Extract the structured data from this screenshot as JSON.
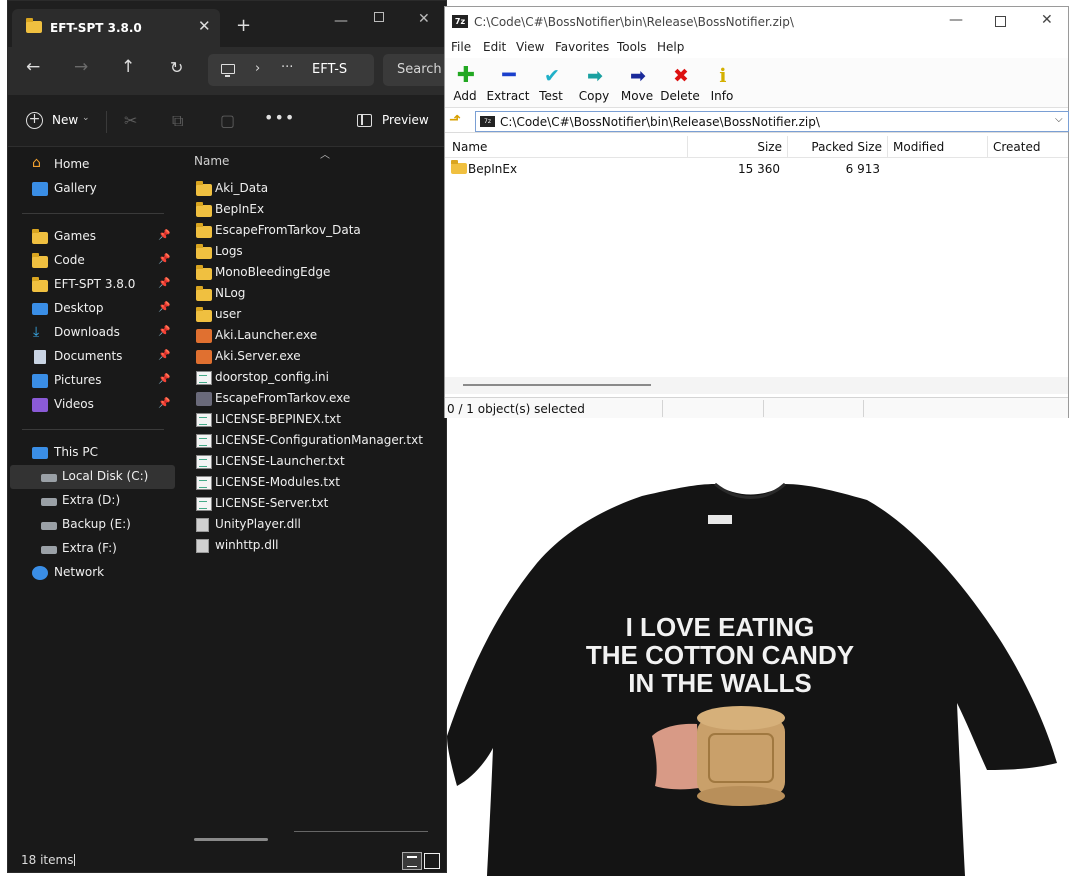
{
  "explorer": {
    "tab_title": "EFT-SPT 3.8.0",
    "address_text": "EFT-S",
    "search_placeholder": "Search",
    "toolbar": {
      "new_label": "New",
      "preview_label": "Preview"
    },
    "column_name": "Name",
    "sidebar": [
      {
        "label": "Home",
        "icon": "home-icon"
      },
      {
        "label": "Gallery",
        "icon": "gallery-icon"
      },
      {
        "label": "Games",
        "icon": "folder-icon",
        "pinned": true
      },
      {
        "label": "Code",
        "icon": "folder-icon",
        "pinned": true
      },
      {
        "label": "EFT-SPT 3.8.0",
        "icon": "folder-icon",
        "pinned": true
      },
      {
        "label": "Desktop",
        "icon": "desktop-icon",
        "pinned": true
      },
      {
        "label": "Downloads",
        "icon": "download-icon",
        "pinned": true
      },
      {
        "label": "Documents",
        "icon": "documents-icon",
        "pinned": true
      },
      {
        "label": "Pictures",
        "icon": "pictures-icon",
        "pinned": true
      },
      {
        "label": "Videos",
        "icon": "videos-icon",
        "pinned": true
      },
      {
        "label": "This PC",
        "icon": "pc-icon"
      },
      {
        "label": "Local Disk (C:)",
        "icon": "drive-icon",
        "selected": true
      },
      {
        "label": "Extra (D:)",
        "icon": "drive-icon"
      },
      {
        "label": "Backup (E:)",
        "icon": "drive-icon"
      },
      {
        "label": "Extra (F:)",
        "icon": "drive-icon"
      },
      {
        "label": "Network",
        "icon": "network-icon"
      }
    ],
    "files": [
      {
        "name": "Aki_Data",
        "type": "folder"
      },
      {
        "name": "BepInEx",
        "type": "folder"
      },
      {
        "name": "EscapeFromTarkov_Data",
        "type": "folder"
      },
      {
        "name": "Logs",
        "type": "folder"
      },
      {
        "name": "MonoBleedingEdge",
        "type": "folder"
      },
      {
        "name": "NLog",
        "type": "folder"
      },
      {
        "name": "user",
        "type": "folder"
      },
      {
        "name": "Aki.Launcher.exe",
        "type": "exe"
      },
      {
        "name": "Aki.Server.exe",
        "type": "exe"
      },
      {
        "name": "doorstop_config.ini",
        "type": "txt"
      },
      {
        "name": "EscapeFromTarkov.exe",
        "type": "exe2"
      },
      {
        "name": "LICENSE-BEPINEX.txt",
        "type": "txt"
      },
      {
        "name": "LICENSE-ConfigurationManager.txt",
        "type": "txt"
      },
      {
        "name": "LICENSE-Launcher.txt",
        "type": "txt"
      },
      {
        "name": "LICENSE-Modules.txt",
        "type": "txt"
      },
      {
        "name": "LICENSE-Server.txt",
        "type": "txt"
      },
      {
        "name": "UnityPlayer.dll",
        "type": "dll"
      },
      {
        "name": "winhttp.dll",
        "type": "dll"
      }
    ],
    "status_text": "18 items"
  },
  "zip": {
    "title": "C:\\Code\\C#\\BossNotifier\\bin\\Release\\BossNotifier.zip\\",
    "logo": "7z",
    "menu": [
      "File",
      "Edit",
      "View",
      "Favorites",
      "Tools",
      "Help"
    ],
    "tools": [
      {
        "label": "Add",
        "icon": "add-icon",
        "color": "#22a822"
      },
      {
        "label": "Extract",
        "icon": "extract-icon",
        "color": "#1a3fcc"
      },
      {
        "label": "Test",
        "icon": "test-icon",
        "color": "#20b0c8"
      },
      {
        "label": "Copy",
        "icon": "copy-icon",
        "color": "#1aa0a0"
      },
      {
        "label": "Move",
        "icon": "move-icon",
        "color": "#1a2a9a"
      },
      {
        "label": "Delete",
        "icon": "delete-icon",
        "color": "#dd1111"
      },
      {
        "label": "Info",
        "icon": "info-icon",
        "color": "#e0c000"
      }
    ],
    "path": "C:\\Code\\C#\\BossNotifier\\bin\\Release\\BossNotifier.zip\\",
    "columns": [
      "Name",
      "Size",
      "Packed Size",
      "Modified",
      "Created"
    ],
    "rows": [
      {
        "name": "BepInEx",
        "size": "15 360",
        "packed": "6 913",
        "modified": "",
        "created": ""
      }
    ],
    "status_text": "0 / 1 object(s) selected"
  },
  "tshirt": {
    "lines": [
      "I LOVE EATING",
      "THE COTTON CANDY",
      "IN THE WALLS"
    ]
  }
}
